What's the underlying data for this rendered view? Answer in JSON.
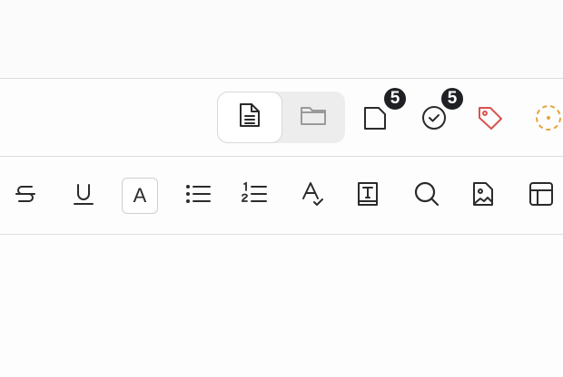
{
  "header": {
    "view_toggle": {
      "selected": "document",
      "options": [
        "document-icon",
        "folder-icon"
      ]
    },
    "notes_badge": "5",
    "tasks_badge": "5",
    "tag_color": "#d9534f",
    "status_color": "#e6a23c"
  },
  "toolbar": {
    "font_color_letter": "A",
    "tools": [
      "strikethrough-icon",
      "underline-icon",
      "font-color-icon",
      "bullet-list-icon",
      "numbered-list-icon",
      "spell-check-icon",
      "text-style-icon",
      "search-icon",
      "image-icon",
      "table-icon"
    ]
  },
  "colors": {
    "icon": "#2b2b2b",
    "muted_icon": "#9a9a9a",
    "badge_bg": "#1f2124",
    "divider": "#dcdcdc"
  }
}
